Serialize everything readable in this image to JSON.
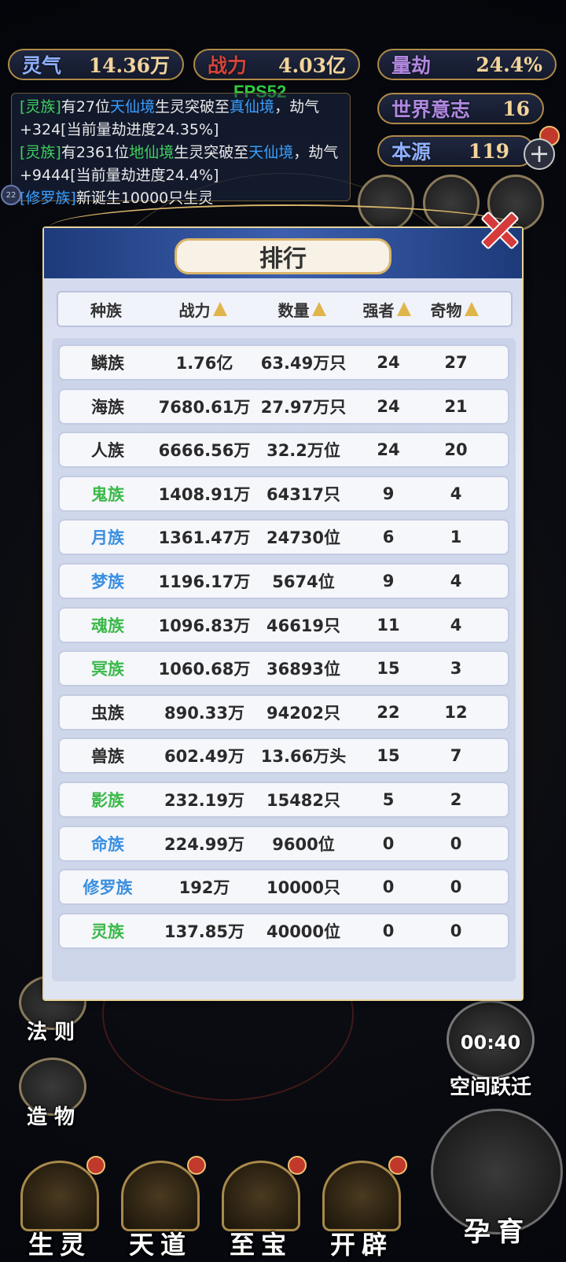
{
  "top_stats": {
    "lingqi": {
      "label": "灵气",
      "value": "14.36万"
    },
    "zhanli": {
      "label": "战力",
      "value": "4.03亿"
    },
    "liangjie": {
      "label": "量劫",
      "value": "24.4%"
    },
    "world_will": {
      "label": "世界意志",
      "value": "16"
    },
    "origin": {
      "label": "本源",
      "value": "119"
    }
  },
  "fps": "FPS52",
  "log": {
    "line1_tag": "[灵族]",
    "line1_text_a": "有27位",
    "line1_realm": "天仙境",
    "line1_text_b": "生灵突破至",
    "line1_realm2": "真仙境",
    "line1_text_c": "，劫气+324[当前量劫进度24.35%]",
    "line2_tag": "[灵族]",
    "line2_text_a": "有2361位",
    "line2_realm": "地仙境",
    "line2_text_b": "生灵突破至",
    "line2_realm2": "天仙境",
    "line2_text_c": "，劫气+9444[当前量劫进度24.4%]",
    "line3_tag": "[修罗族]",
    "line3_text": "新诞生10000只生灵"
  },
  "side_left": {
    "fa_ze": "法 则",
    "zao_wu": "造 物"
  },
  "panel": {
    "title": "排行",
    "headers": {
      "race": "种族",
      "power": "战力",
      "count": "数量",
      "strong": "强者",
      "treasure": "奇物"
    },
    "colors": {
      "green": "#3cb94b",
      "blue": "#3a8fe0",
      "default": "#2a2a2a"
    },
    "rows": [
      {
        "race": "鳞族",
        "power": "1.76亿",
        "count": "63.49万只",
        "strong": "24",
        "treasure": "27",
        "color": "default"
      },
      {
        "race": "海族",
        "power": "7680.61万",
        "count": "27.97万只",
        "strong": "24",
        "treasure": "21",
        "color": "default"
      },
      {
        "race": "人族",
        "power": "6666.56万",
        "count": "32.2万位",
        "strong": "24",
        "treasure": "20",
        "color": "default"
      },
      {
        "race": "鬼族",
        "power": "1408.91万",
        "count": "64317只",
        "strong": "9",
        "treasure": "4",
        "color": "green"
      },
      {
        "race": "月族",
        "power": "1361.47万",
        "count": "24730位",
        "strong": "6",
        "treasure": "1",
        "color": "blue"
      },
      {
        "race": "梦族",
        "power": "1196.17万",
        "count": "5674位",
        "strong": "9",
        "treasure": "4",
        "color": "blue"
      },
      {
        "race": "魂族",
        "power": "1096.83万",
        "count": "46619只",
        "strong": "11",
        "treasure": "4",
        "color": "green"
      },
      {
        "race": "冥族",
        "power": "1060.68万",
        "count": "36893位",
        "strong": "15",
        "treasure": "3",
        "color": "green"
      },
      {
        "race": "虫族",
        "power": "890.33万",
        "count": "94202只",
        "strong": "22",
        "treasure": "12",
        "color": "default"
      },
      {
        "race": "兽族",
        "power": "602.49万",
        "count": "13.66万头",
        "strong": "15",
        "treasure": "7",
        "color": "default"
      },
      {
        "race": "影族",
        "power": "232.19万",
        "count": "15482只",
        "strong": "5",
        "treasure": "2",
        "color": "green"
      },
      {
        "race": "命族",
        "power": "224.99万",
        "count": "9600位",
        "strong": "0",
        "treasure": "0",
        "color": "blue"
      },
      {
        "race": "修罗族",
        "power": "192万",
        "count": "10000只",
        "strong": "0",
        "treasure": "0",
        "color": "blue"
      },
      {
        "race": "灵族",
        "power": "137.85万",
        "count": "40000位",
        "strong": "0",
        "treasure": "0",
        "color": "green"
      }
    ]
  },
  "timer": {
    "time": "00:40",
    "label": "空间跃迁"
  },
  "bottom_nav": {
    "shengling": "生灵",
    "tiandao": "天道",
    "zhibao": "至宝",
    "kaipi": "开辟",
    "yunyu": "孕育"
  }
}
